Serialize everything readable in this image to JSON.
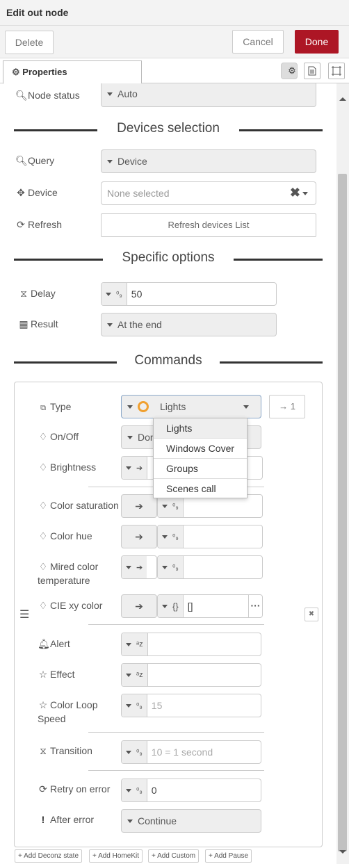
{
  "title": "Edit out node",
  "toolbar": {
    "delete": "Delete",
    "cancel": "Cancel",
    "done": "Done"
  },
  "tabs": {
    "properties": "Properties"
  },
  "colors": {
    "done": "#ad1625",
    "section_line": "#333333",
    "accent_orange": "#f0a030"
  },
  "fields": {
    "node_status": {
      "label": "Node status",
      "value": "Auto"
    },
    "query": {
      "label": "Query",
      "value": "Device"
    },
    "device": {
      "label": "Device",
      "placeholder": "None selected"
    },
    "refresh": {
      "label": "Refresh",
      "button": "Refresh devices List"
    },
    "delay": {
      "label": "Delay",
      "value": "50"
    },
    "result": {
      "label": "Result",
      "value": "At the end"
    }
  },
  "sections": {
    "devices": "Devices selection",
    "specific": "Specific options",
    "commands": "Commands"
  },
  "commands": {
    "type": {
      "label": "Type",
      "value": "Lights",
      "output": "→ 1"
    },
    "type_options": [
      "Lights",
      "Windows Cover",
      "Groups",
      "Scenes call"
    ],
    "onoff": {
      "label": "On/Off",
      "value": "Don"
    },
    "brightness": {
      "label": "Brightness"
    },
    "color_saturation": {
      "label": "Color saturation"
    },
    "color_hue": {
      "label": "Color hue"
    },
    "mired_line1": "Mired color",
    "mired_line2": "temperature",
    "cie": {
      "label": "CIE xy color",
      "value": "[]",
      "prefix": "{}"
    },
    "alert": {
      "label": "Alert"
    },
    "effect": {
      "label": "Effect"
    },
    "colorloop_line1": "Color Loop",
    "colorloop_line2": "Speed",
    "colorloop_placeholder": "15",
    "transition": {
      "label": "Transition",
      "placeholder": "10 = 1 second"
    },
    "retry": {
      "label": "Retry on error",
      "value": "0"
    },
    "after_error": {
      "label": "After error",
      "value": "Continue"
    }
  },
  "bottom": {
    "add_deconz": "Add Deconz state",
    "add_homekit": "Add HomeKit",
    "add_custom": "Add Custom",
    "add_pause": "Add Pause"
  }
}
